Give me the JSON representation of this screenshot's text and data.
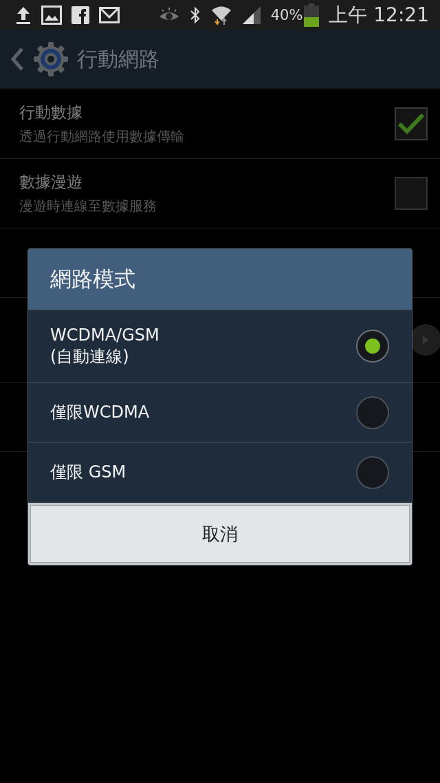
{
  "status_bar": {
    "battery_percent": "40%",
    "time": "上午 12:21"
  },
  "header": {
    "title": "行動網路"
  },
  "settings": [
    {
      "kind": "checkbox",
      "title": "行動數據",
      "subtitle": "透過行動網路使用數據傳輸",
      "checked": true
    },
    {
      "kind": "checkbox",
      "title": "數據漫遊",
      "subtitle": "漫遊時連線至數據服務",
      "checked": false
    },
    {
      "kind": "plain"
    },
    {
      "kind": "arrow"
    },
    {
      "kind": "plain"
    }
  ],
  "dialog": {
    "title": "網路模式",
    "options": [
      {
        "label": "WCDMA/GSM\n(自動連線)",
        "selected": true
      },
      {
        "label": "僅限WCDMA",
        "selected": false
      },
      {
        "label": "僅限 GSM",
        "selected": false
      }
    ],
    "cancel": "取消"
  }
}
